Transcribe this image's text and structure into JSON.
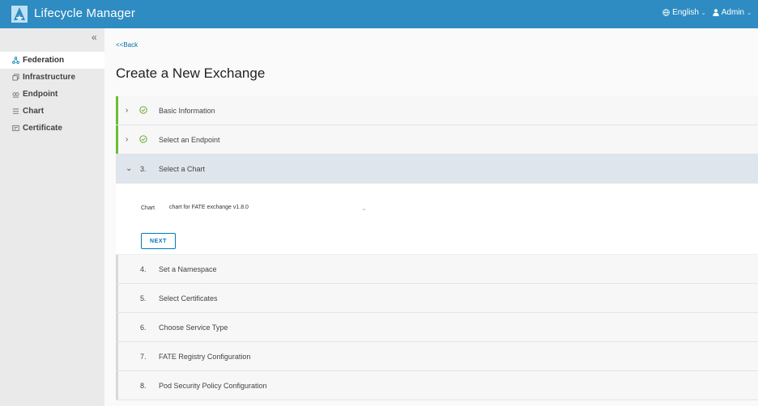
{
  "header": {
    "title": "Lifecycle Manager",
    "language": "English",
    "user": "Admin",
    "color": "#2e8cc2"
  },
  "sidebar": {
    "collapse_icon": "double-chevron-left-icon",
    "items": [
      {
        "label": "Federation",
        "icon": "federation-icon",
        "active": true
      },
      {
        "label": "Infrastructure",
        "icon": "infrastructure-icon",
        "active": false
      },
      {
        "label": "Endpoint",
        "icon": "endpoint-icon",
        "active": false
      },
      {
        "label": "Chart",
        "icon": "chart-icon",
        "active": false
      },
      {
        "label": "Certificate",
        "icon": "certificate-icon",
        "active": false
      }
    ]
  },
  "main": {
    "back_link": "<<Back",
    "title": "Create a New Exchange",
    "steps": [
      {
        "label": "Basic Information",
        "status": "done"
      },
      {
        "label": "Select an Endpoint",
        "status": "done"
      },
      {
        "number": "3.",
        "label": "Select a Chart",
        "status": "current"
      },
      {
        "number": "4.",
        "label": "Set a Namespace",
        "status": "pending"
      },
      {
        "number": "5.",
        "label": "Select Certificates",
        "status": "pending"
      },
      {
        "number": "6.",
        "label": "Choose Service Type",
        "status": "pending"
      },
      {
        "number": "7.",
        "label": "FATE Registry Configuration",
        "status": "pending"
      },
      {
        "number": "8.",
        "label": "Pod Security Policy Configuration",
        "status": "pending"
      }
    ],
    "chart_form": {
      "label": "Chart",
      "selected": "chart for FATE exchange v1.8.0",
      "next_button": "NEXT"
    }
  }
}
